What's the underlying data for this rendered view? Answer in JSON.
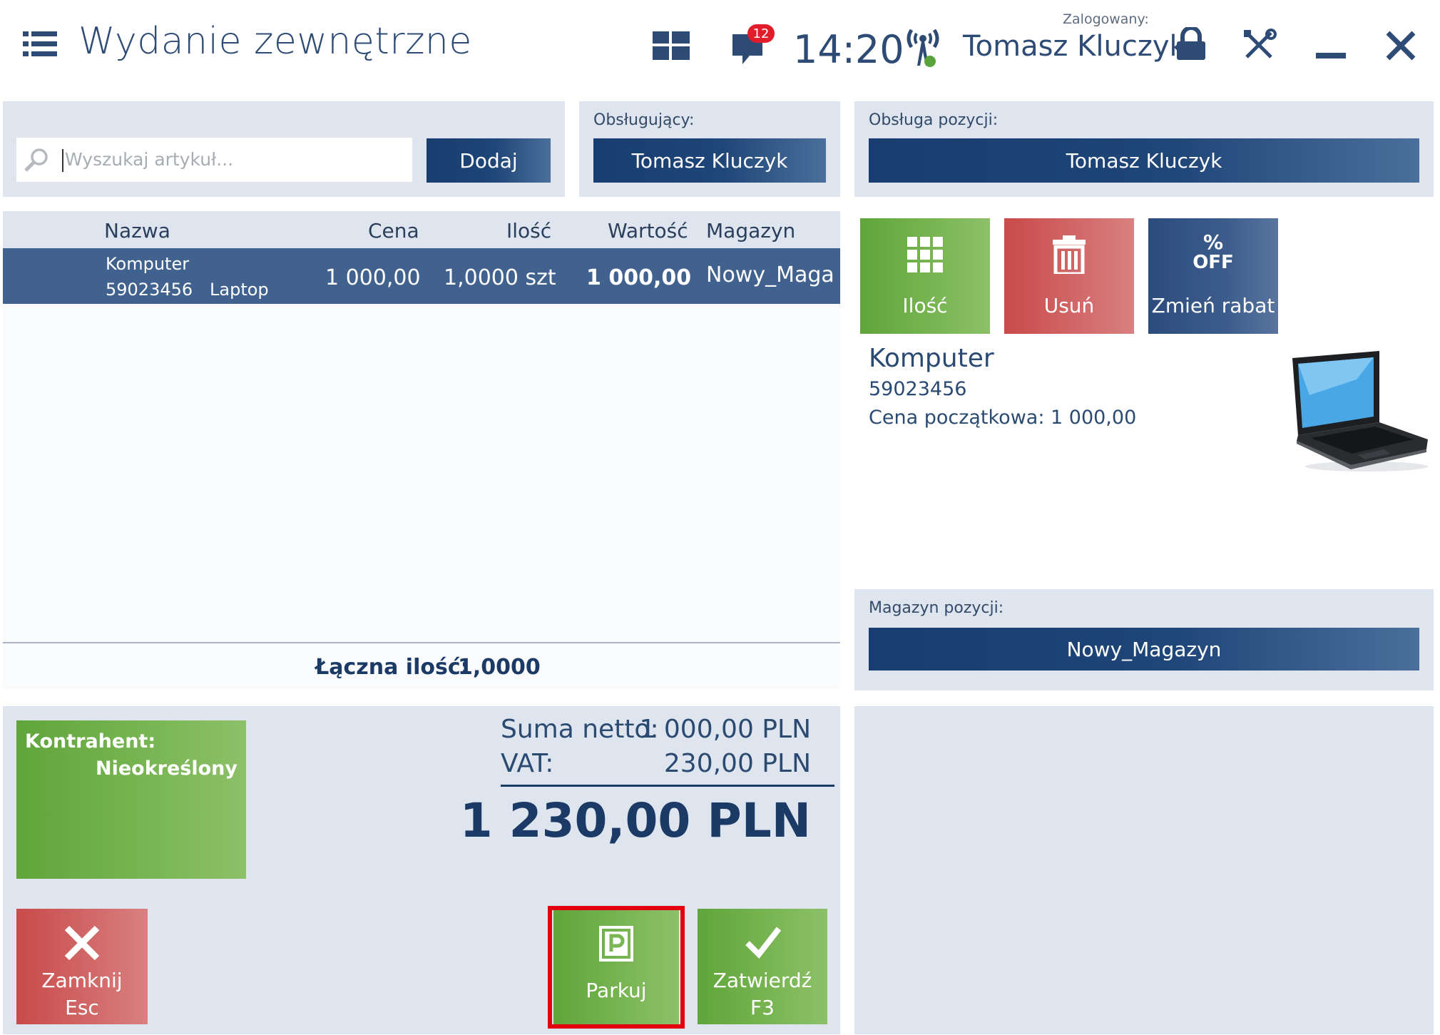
{
  "header": {
    "title": "Wydanie zewnętrzne",
    "notifications_count": "12",
    "time": "14:20",
    "logged_label": "Zalogowany:",
    "user_name": "Tomasz Kluczyk"
  },
  "search": {
    "placeholder": "Wyszukaj artykuł...",
    "add_label": "Dodaj"
  },
  "operator": {
    "label": "Obsługujący:",
    "value": "Tomasz Kluczyk"
  },
  "item_handling": {
    "label": "Obsługa pozycji:",
    "value": "Tomasz Kluczyk"
  },
  "table": {
    "columns": [
      "Nazwa",
      "Cena",
      "Ilość",
      "Wartość",
      "Magazyn"
    ],
    "rows": [
      {
        "name": "Komputer",
        "code": "59023456",
        "category": "Laptop",
        "price": "1 000,00",
        "quantity": "1,0000 szt",
        "value": "1 000,00",
        "warehouse": "Nowy_Maga"
      }
    ],
    "total_label": "Łączna ilość:",
    "total_value": "1,0000"
  },
  "actions": {
    "quantity": "Ilość",
    "delete": "Usuń",
    "discount_pct": "%",
    "discount_off": "OFF",
    "discount": "Zmień rabat"
  },
  "product": {
    "name": "Komputer",
    "code": "59023456",
    "initial_price": "Cena początkowa: 1 000,00"
  },
  "item_warehouse": {
    "label": "Magazyn pozycji:",
    "value": "Nowy_Magazyn"
  },
  "contractor": {
    "label": "Kontrahent:",
    "value": "Nieokreślony"
  },
  "totals": {
    "net_label": "Suma netto:",
    "net_value": "1 000,00 PLN",
    "vat_label": "VAT:",
    "vat_value": "230,00 PLN",
    "grand": "1 230,00 PLN"
  },
  "footer": {
    "close_label": "Zamknij",
    "close_key": "Esc",
    "park_label": "Parkuj",
    "confirm_label": "Zatwierdź",
    "confirm_key": "F3"
  },
  "colors": {
    "navy": "#1f4678",
    "green": "#7ab654",
    "red": "#d26a6a",
    "panel": "#dfe5ee",
    "highlight": "#e3000f"
  },
  "icons": [
    "menu-icon",
    "tiles-icon",
    "chat-icon",
    "antenna-icon",
    "lock-icon",
    "tools-icon",
    "minimize-icon",
    "close-icon",
    "search-icon",
    "grid-icon",
    "trash-icon",
    "percent-off-icon",
    "x-icon",
    "parking-icon",
    "check-icon"
  ]
}
